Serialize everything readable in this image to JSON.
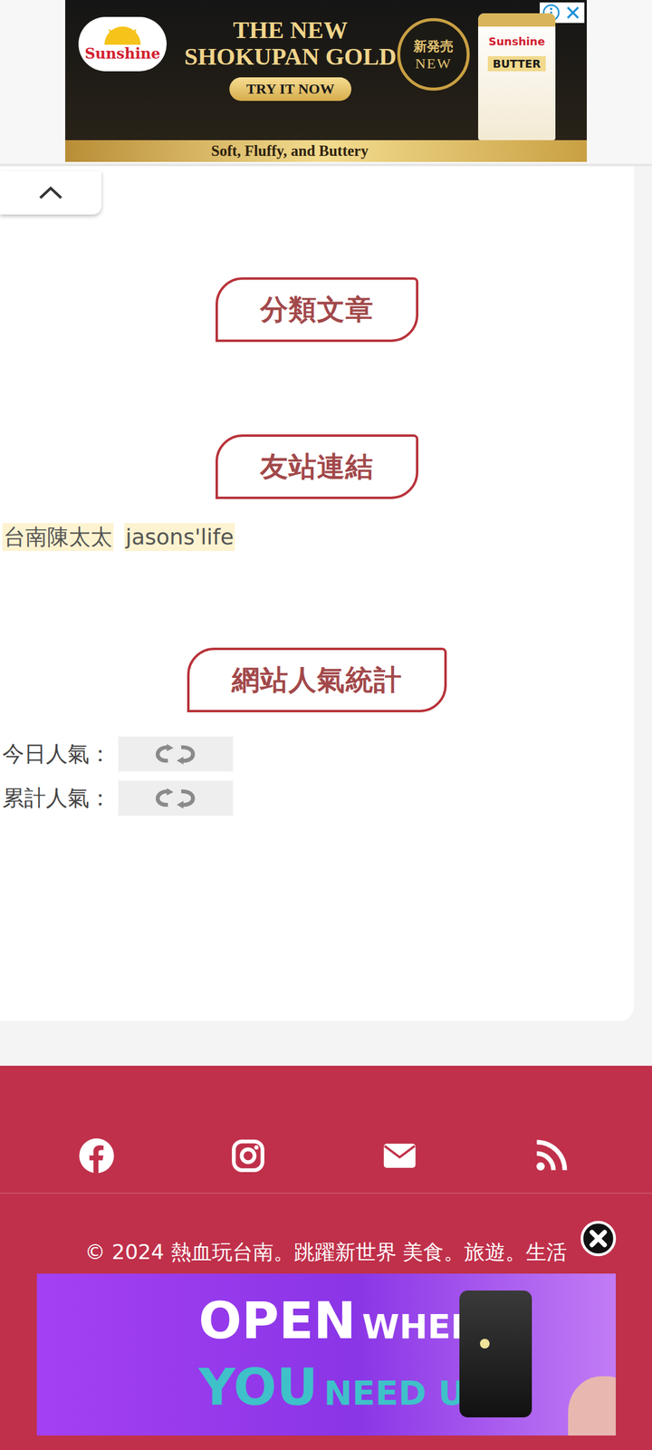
{
  "top_ad": {
    "brand": "Sunshine",
    "line1": "THE NEW",
    "line2": "SHOKUPAN GOLD",
    "button": "TRY IT NOW",
    "tagline": "Soft, Fluffy, and Buttery",
    "badge_jp": "新発売",
    "badge_en": "NEW",
    "pack_brand": "Sunshine",
    "pack_label": "BUTTER"
  },
  "categories": {
    "title": "分類文章"
  },
  "friend_links": {
    "title": "友站連結",
    "links": [
      "台南陳太太",
      "jasons'life"
    ]
  },
  "stats": {
    "title": "網站人氣統計",
    "rows": [
      {
        "label": "今日人氣："
      },
      {
        "label": "累計人氣："
      }
    ]
  },
  "copyright": "© 2024 熱血玩台南。跳躍新世界 美食。旅遊。生活",
  "bottom_ad": {
    "word1": "OPEN",
    "word2": "WHEN",
    "word3": "YOU",
    "word4": "NEED US"
  }
}
